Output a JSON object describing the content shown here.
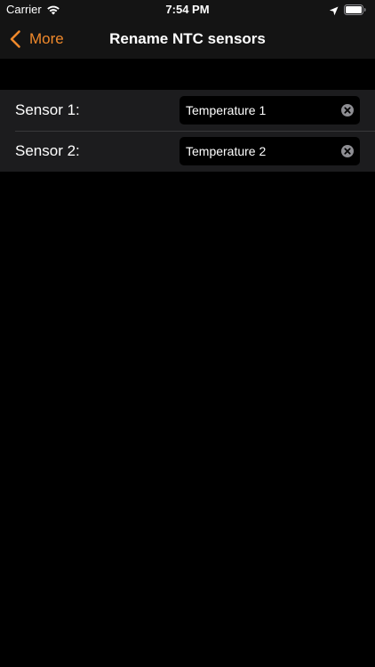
{
  "status_bar": {
    "carrier": "Carrier",
    "time": "7:54 PM",
    "icons": [
      "wifi-icon",
      "location-icon",
      "battery-icon"
    ]
  },
  "nav": {
    "back_label": "More",
    "title": "Rename NTC sensors",
    "back_icon": "chevron-left-icon"
  },
  "sensors": [
    {
      "label": "Sensor 1:",
      "value": "Temperature 1"
    },
    {
      "label": "Sensor 2:",
      "value": "Temperature 2"
    }
  ],
  "colors": {
    "accent": "#f0892b",
    "background": "#000000",
    "bar": "#141414",
    "cell": "#1c1c1e",
    "separator": "#38383a",
    "clear_icon": "#8e8e93"
  }
}
